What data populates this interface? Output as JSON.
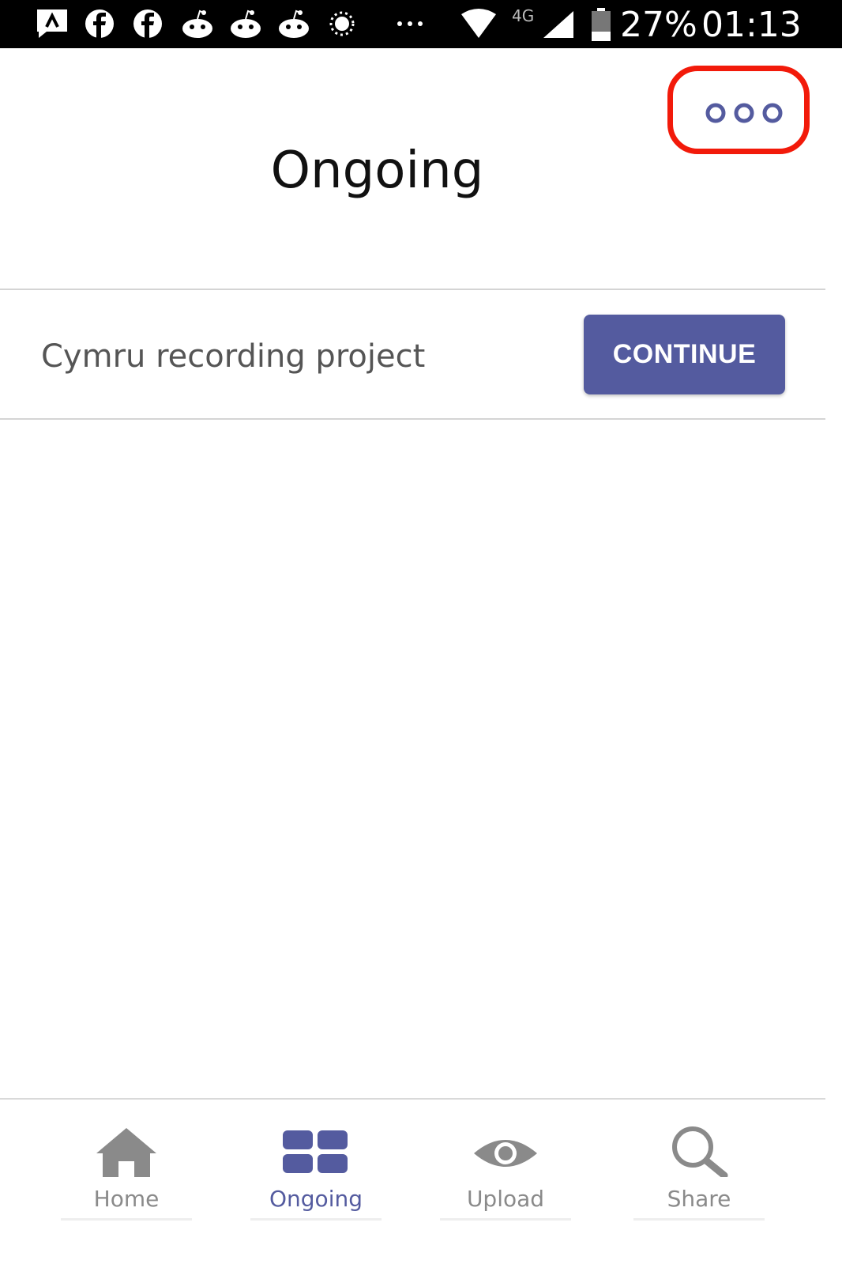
{
  "status_bar": {
    "network": "4G",
    "battery": "27%",
    "time": "01:13",
    "icons": [
      "notification-icon",
      "facebook-icon",
      "facebook-icon",
      "reddit-icon",
      "reddit-icon",
      "reddit-icon",
      "brightness-icon",
      "more-dots-icon",
      "wifi-icon",
      "signal-icon",
      "battery-icon"
    ]
  },
  "header": {
    "title": "Ongoing",
    "more_icon": "more-options-icon",
    "highlight_color": "#f21a0a"
  },
  "projects": [
    {
      "name": "Cymru recording project",
      "action_label": "CONTINUE"
    }
  ],
  "bottom_nav": {
    "items": [
      {
        "label": "Home",
        "icon": "home-icon",
        "active": false
      },
      {
        "label": "Ongoing",
        "icon": "grid-icon",
        "active": true
      },
      {
        "label": "Upload",
        "icon": "eye-icon",
        "active": false
      },
      {
        "label": "Share",
        "icon": "search-icon",
        "active": false
      }
    ]
  },
  "colors": {
    "accent": "#545b9f",
    "inactive": "#8a8a8a",
    "status_bar": "#000000"
  }
}
